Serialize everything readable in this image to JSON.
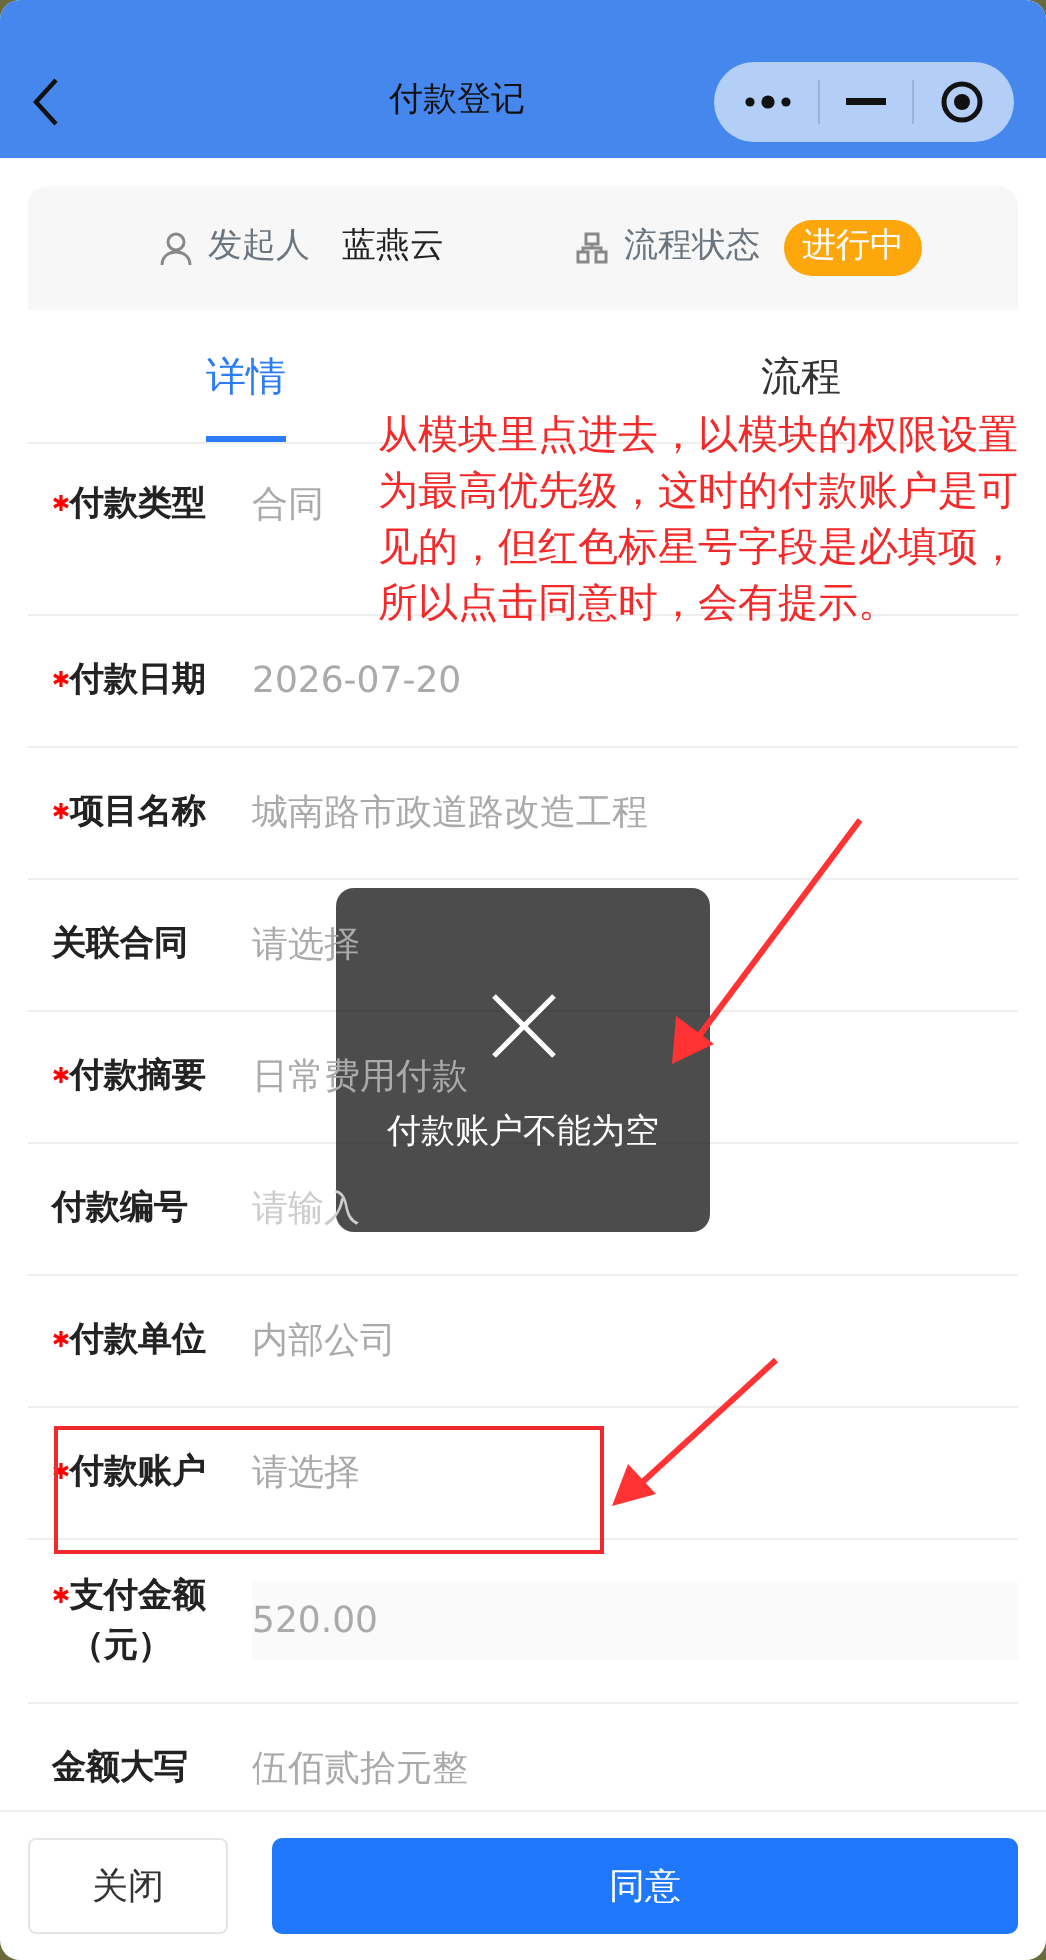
{
  "nav": {
    "title": "付款登记"
  },
  "info": {
    "initiator_label": "发起人",
    "initiator": "蓝燕云",
    "status_label": "流程状态",
    "status": "进行中"
  },
  "tabs": [
    {
      "label": "详情",
      "selected": true
    },
    {
      "label": "流程",
      "selected": false
    }
  ],
  "fields": [
    {
      "label": "付款类型",
      "required": true,
      "value": "合同"
    },
    {
      "label": "付款日期",
      "required": true,
      "value": "2026-07-20"
    },
    {
      "label": "项目名称",
      "required": true,
      "value": "城南路市政道路改造工程"
    },
    {
      "label": "关联合同",
      "required": false,
      "value": "请选择"
    },
    {
      "label": "付款摘要",
      "required": true,
      "value": "日常费用付款"
    },
    {
      "label": "付款编号",
      "required": false,
      "placeholder": "请输入"
    },
    {
      "label": "付款单位",
      "required": true,
      "value": "内部公司"
    },
    {
      "label": "付款账户",
      "required": true,
      "value": "请选择",
      "highlighted": true
    },
    {
      "label": "支付金额（元）",
      "required": true,
      "value": "520.00",
      "disabled": true
    },
    {
      "label": "金额大写",
      "required": false,
      "value": "伍佰贰拾元整"
    }
  ],
  "toast": {
    "message": "付款账户不能为空"
  },
  "annotation": {
    "text": "从模块里点进去，以模块的权限设置为最高优先级，这时的付款账户是可见的，但红色标星号字段是必填项，所以点击同意时，会有提示。"
  },
  "footer": {
    "buttons": [
      {
        "label": "关闭",
        "kind": "secondary"
      },
      {
        "label": "同意",
        "kind": "primary"
      }
    ]
  }
}
